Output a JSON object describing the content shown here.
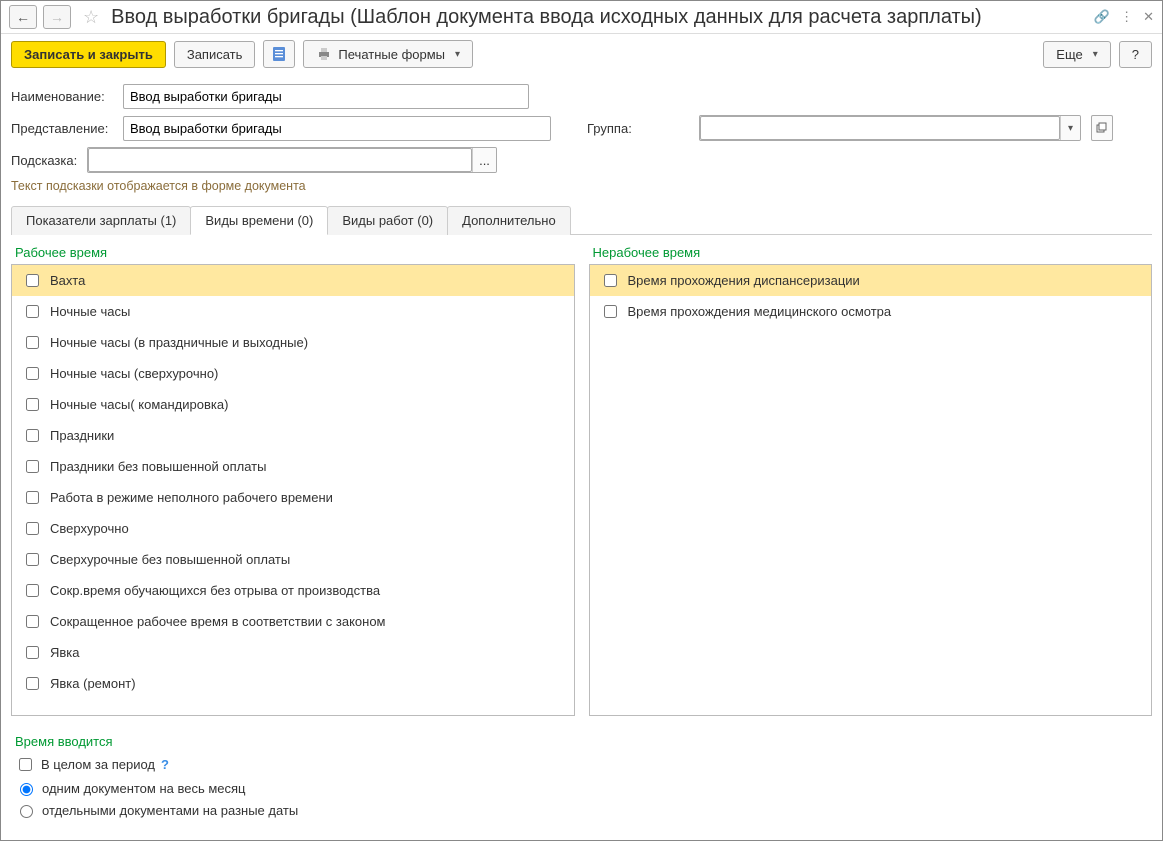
{
  "title": "Ввод выработки бригады (Шаблон документа ввода исходных данных для расчета зарплаты)",
  "toolbar": {
    "save_close": "Записать и закрыть",
    "save": "Записать",
    "print_forms": "Печатные формы",
    "more": "Еще",
    "help": "?"
  },
  "form": {
    "name_label": "Наименование:",
    "name_value": "Ввод выработки бригады",
    "repr_label": "Представление:",
    "repr_value": "Ввод выработки бригады",
    "group_label": "Группа:",
    "group_value": "",
    "hint_label": "Подсказка:",
    "hint_value": "",
    "hint_btn": "...",
    "hint_help": "Текст подсказки отображается в форме документа"
  },
  "tabs": [
    {
      "label": "Показатели зарплаты (1)"
    },
    {
      "label": "Виды времени (0)"
    },
    {
      "label": "Виды работ (0)"
    },
    {
      "label": "Дополнительно"
    }
  ],
  "columns": {
    "left_heading": "Рабочее время",
    "right_heading": "Нерабочее время",
    "left_items": [
      "Вахта",
      "Ночные часы",
      "Ночные часы (в праздничные и выходные)",
      "Ночные часы (сверхурочно)",
      "Ночные часы( командировка)",
      "Праздники",
      "Праздники без повышенной оплаты",
      "Работа в режиме неполного рабочего времени",
      "Сверхурочно",
      "Сверхурочные без повышенной оплаты",
      "Сокр.время обучающихся без отрыва от производства",
      "Сокращенное рабочее время в соответствии с законом",
      "Явка",
      "Явка (ремонт)"
    ],
    "right_items": [
      "Время прохождения диспансеризации",
      "Время прохождения медицинского осмотра"
    ]
  },
  "bottom": {
    "heading": "Время вводится",
    "whole_period": "В целом за период",
    "radio1": "одним документом на весь месяц",
    "radio2": "отдельными документами на разные даты"
  }
}
